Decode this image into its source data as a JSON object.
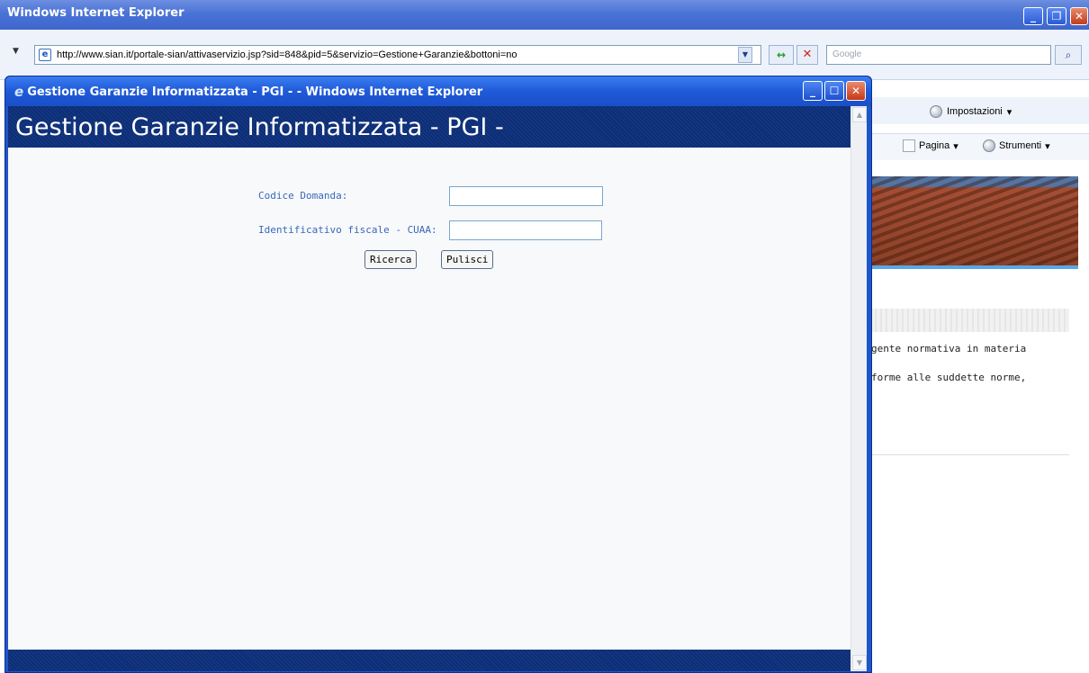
{
  "outer_window": {
    "title": "Windows Internet Explorer",
    "url": "http://www.sian.it/portale-sian/attivaservizio.jsp?sid=848&pid=5&servizio=Gestione+Garanzie&bottoni=no",
    "search_placeholder": "Google"
  },
  "background_page": {
    "settings_label": "Impostazioni",
    "page_menu": "Pagina",
    "tools_menu": "Strumenti",
    "text_line_1": "gente normativa in materia",
    "text_line_2": "forme alle suddette norme,"
  },
  "popup": {
    "title": "Gestione Garanzie Informatizzata - PGI - - Windows Internet Explorer",
    "header_title": "Gestione Garanzie Informatizzata - PGI -",
    "form": {
      "codice_domanda_label": "Codice Domanda:",
      "codice_domanda_value": "",
      "cuaa_label": "Identificativo fiscale - CUAA:",
      "cuaa_value": "",
      "search_button": "Ricerca",
      "clear_button": "Pulisci"
    }
  },
  "colors": {
    "title_blue": "#1f56c9",
    "header_band": "#0c2e78",
    "label_blue": "#3c67b8"
  }
}
